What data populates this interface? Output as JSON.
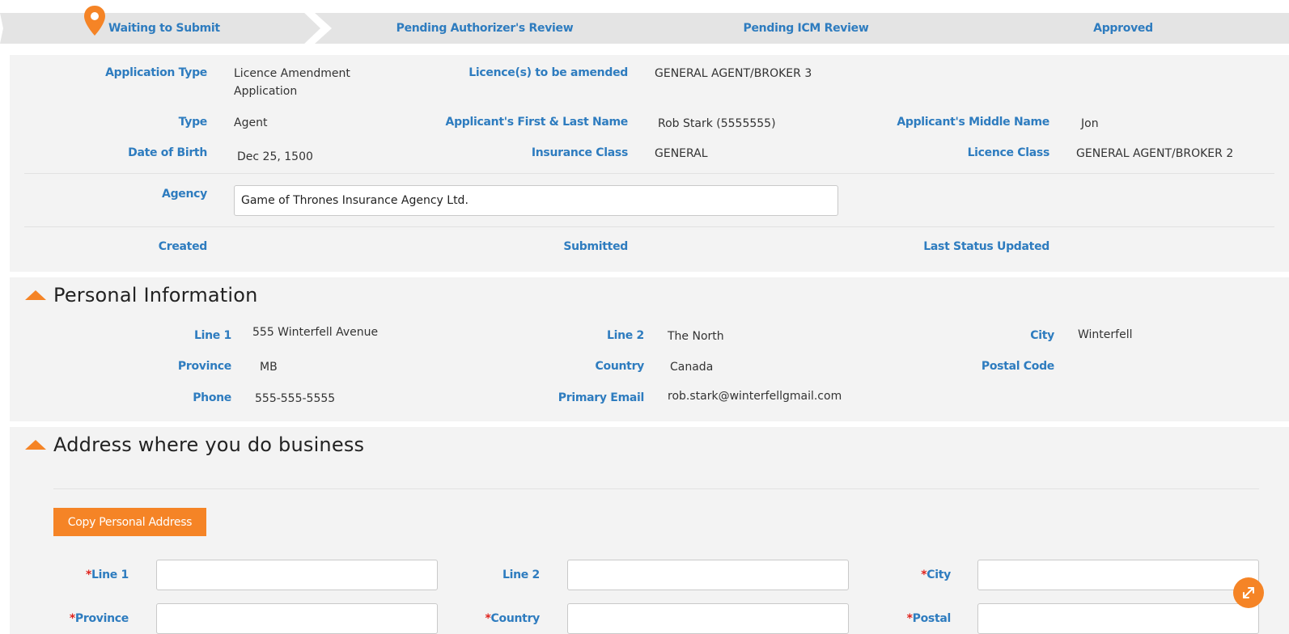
{
  "steps": [
    {
      "label": "Waiting to Submit"
    },
    {
      "label": "Pending Authorizer's Review"
    },
    {
      "label": "Pending ICM Review"
    },
    {
      "label": "Approved"
    }
  ],
  "application": {
    "application_type_label": "Application Type",
    "application_type_line1": "Licence Amendment",
    "application_type_line2": "Application",
    "licences_label": "Licence(s) to be amended",
    "licences_value": "GENERAL AGENT/BROKER 3",
    "type_label": "Type",
    "type_value": "Agent",
    "name_label": "Applicant's First & Last Name",
    "name_value": "Rob Stark (5555555)",
    "middle_label": "Applicant's Middle Name",
    "middle_value": "Jon",
    "dob_label": "Date of Birth",
    "dob_value": "Dec 25, 1500",
    "insurance_class_label": "Insurance Class",
    "insurance_class_value": "GENERAL",
    "licence_class_label": "Licence Class",
    "licence_class_value": "GENERAL AGENT/BROKER 2",
    "agency_label": "Agency",
    "agency_value": "Game of Thrones Insurance Agency Ltd.",
    "created_label": "Created",
    "submitted_label": "Submitted",
    "last_status_label": "Last Status Updated"
  },
  "personal": {
    "title": "Personal Information",
    "line1_label": "Line 1",
    "line1_value": "555 Winterfell Avenue",
    "line2_label": "Line 2",
    "line2_value": "The North",
    "city_label": "City",
    "city_value": "Winterfell",
    "province_label": "Province",
    "province_value": "MB",
    "country_label": "Country",
    "country_value": "Canada",
    "postal_label": "Postal Code",
    "postal_value": "",
    "phone_label": "Phone",
    "phone_value": "555-555-5555",
    "email_label": "Primary Email",
    "email_value": "rob.stark@winterfellgmail.com"
  },
  "business": {
    "title": "Address where you do business",
    "copy_button": "Copy Personal Address",
    "required_mark": "*",
    "line1_label": "Line 1",
    "line2_label": "Line 2",
    "city_label": "City",
    "province_label": "Province",
    "country_label": "Country",
    "postal_label": "Postal"
  },
  "colors": {
    "accent": "#f58426",
    "label": "#2e7cbf",
    "required": "#e0231d"
  },
  "icons": {
    "current_step": "map-pin-icon",
    "collapse": "caret-up-icon",
    "fab": "expand-icon"
  }
}
